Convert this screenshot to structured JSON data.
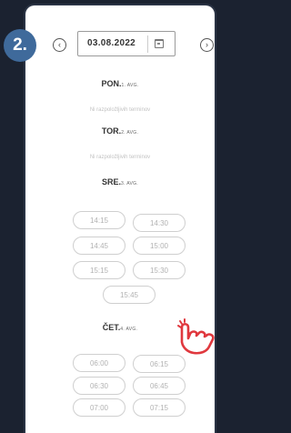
{
  "step": {
    "number": "2."
  },
  "date": {
    "value": "03.08.2022"
  },
  "days": [
    {
      "name": "PON.",
      "date": "1. AVG.",
      "empty": "Ni razpoložljivih terminov"
    },
    {
      "name": "TOR.",
      "date": "2. AVG.",
      "empty": "Ni razpoložljivih terminov"
    },
    {
      "name": "SRE.",
      "date": "3. AVG.",
      "slots": [
        "14:15",
        "14:30",
        "14:45",
        "15:00",
        "15:15",
        "15:30",
        "15:45"
      ]
    },
    {
      "name": "ČET.",
      "date": "4. AVG.",
      "slots": [
        "06:00",
        "06:15",
        "06:30",
        "06:45",
        "07:00",
        "07:15"
      ]
    }
  ],
  "icons": {
    "prev": "chevron-left-icon",
    "next": "chevron-right-icon",
    "calendar": "calendar-icon",
    "pointer": "hand-pointer-icon"
  },
  "colors": {
    "badge": "#3f6a9b",
    "pointer": "#e0383e"
  }
}
